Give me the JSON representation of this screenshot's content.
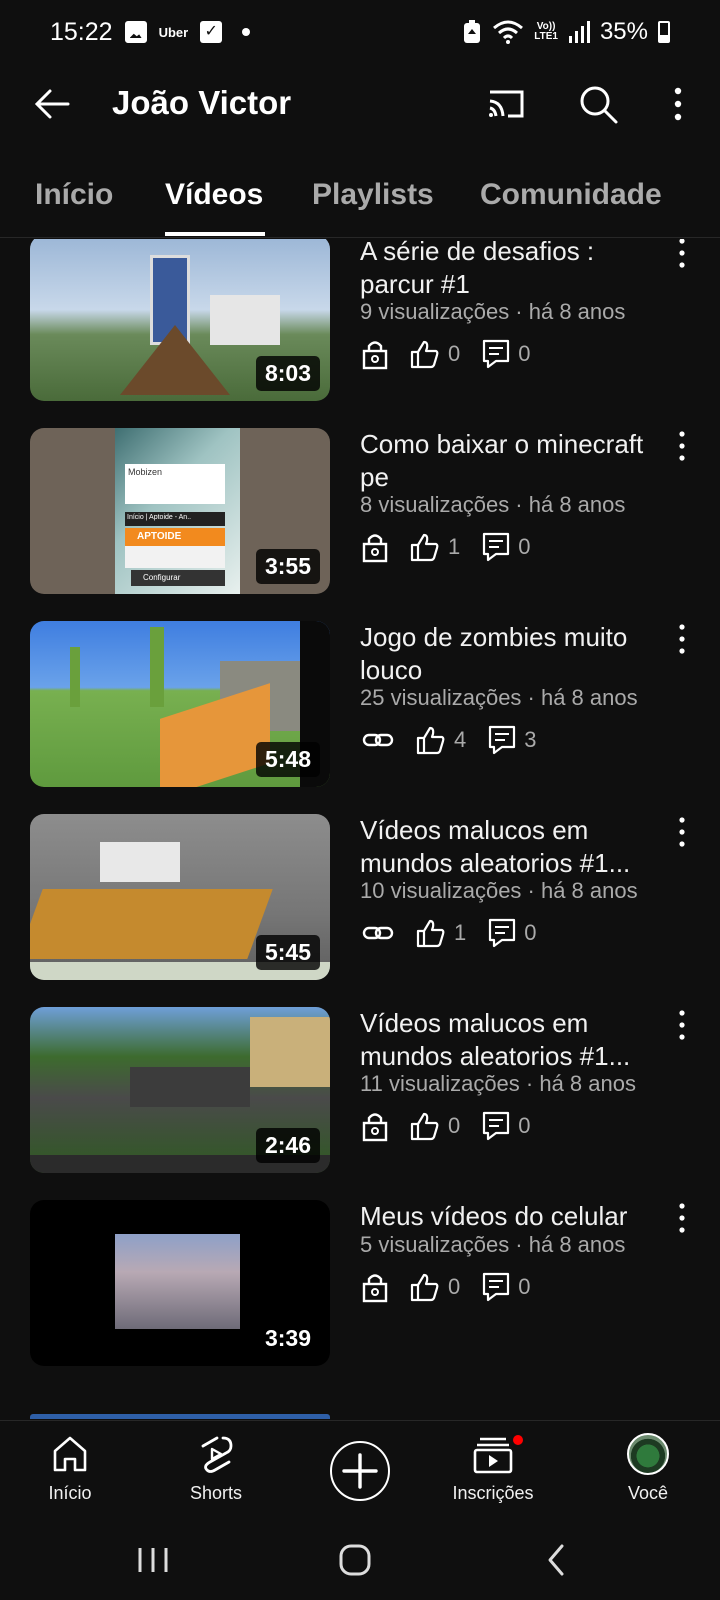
{
  "status_bar": {
    "time": "15:22",
    "uber_label": "Uber",
    "network_label_top": "Vo))",
    "network_label_bottom": "LTE1",
    "battery": "35%",
    "icons": [
      "gallery-icon",
      "uber-icon",
      "checkbox-icon",
      "dot-icon",
      "recycle-icon",
      "wifi-icon",
      "signal-icon",
      "battery-icon"
    ]
  },
  "header": {
    "title": "João Victor",
    "icons": [
      "back-arrow-icon",
      "cast-icon",
      "search-icon",
      "more-vert-icon"
    ]
  },
  "tabs": [
    {
      "label": "Início",
      "active": false
    },
    {
      "label": "Vídeos",
      "active": true
    },
    {
      "label": "Playlists",
      "active": false
    },
    {
      "label": "Comunidade",
      "active": false
    }
  ],
  "videos": [
    {
      "title": "A série de desafios : parcur #1",
      "meta": "9 visualizações · há 8 anos",
      "duration": "8:03",
      "visibility": "private",
      "likes": "0",
      "comments": "0"
    },
    {
      "title": "Como baixar o minecraft pe",
      "meta": "8 visualizações · há 8 anos",
      "duration": "3:55",
      "visibility": "private",
      "likes": "1",
      "comments": "0"
    },
    {
      "title": "Jogo de zombies muito louco",
      "meta": "25 visualizações · há 8 anos",
      "duration": "5:48",
      "visibility": "unlisted",
      "likes": "4",
      "comments": "3"
    },
    {
      "title": "Vídeos malucos em mundos aleatorios #1...",
      "meta": "10 visualizações · há 8 anos",
      "duration": "5:45",
      "visibility": "unlisted",
      "likes": "1",
      "comments": "0"
    },
    {
      "title": "Vídeos malucos em mundos aleatorios #1...",
      "meta": "11 visualizações · há 8 anos",
      "duration": "2:46",
      "visibility": "private",
      "likes": "0",
      "comments": "0"
    },
    {
      "title": "Meus vídeos do celular",
      "meta": "5 visualizações · há 8 anos",
      "duration": "3:39",
      "visibility": "private",
      "likes": "0",
      "comments": "0"
    }
  ],
  "thumb_texts": {
    "mobizen": "Mobizen",
    "inicio_aptoide": "Início | Aptoide - An..",
    "aptoide": "APTOIDE",
    "configurar": "Configurar"
  },
  "bottom_nav": {
    "items": [
      {
        "label": "Início",
        "icon": "home-icon"
      },
      {
        "label": "Shorts",
        "icon": "shorts-icon"
      },
      {
        "label": "",
        "icon": "create-plus-icon"
      },
      {
        "label": "Inscrições",
        "icon": "subscriptions-icon"
      },
      {
        "label": "Você",
        "icon": "avatar"
      }
    ]
  },
  "colors": {
    "background": "#0f0f0f",
    "text_primary": "#f1f1f1",
    "text_secondary": "#aaaaaa",
    "notification": "#ff0000"
  }
}
